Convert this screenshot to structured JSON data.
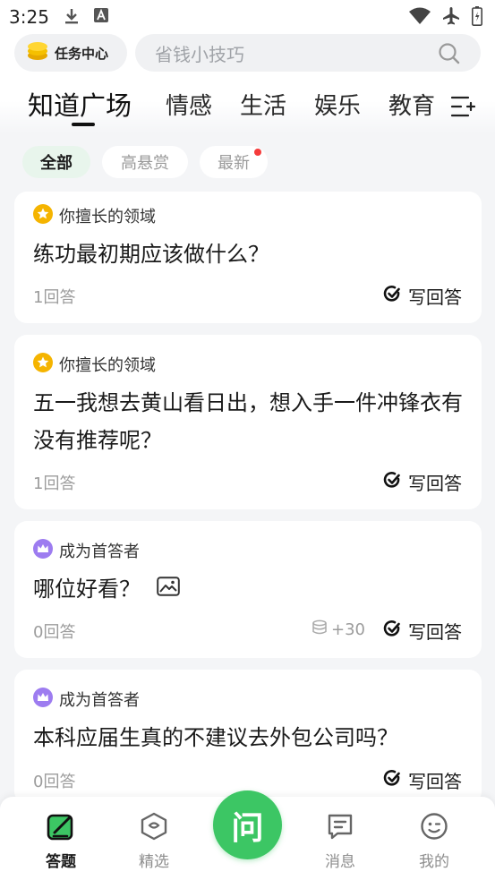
{
  "status_bar": {
    "time": "3:25",
    "left_icons": [
      "download-icon",
      "font-icon"
    ],
    "right_icons": [
      "wifi-icon",
      "airplane-icon",
      "battery-icon"
    ]
  },
  "header": {
    "task_center_label": "任务中心",
    "search_placeholder": "省钱小技巧"
  },
  "category_tabs": [
    {
      "label": "知道广场",
      "active": true
    },
    {
      "label": "情感",
      "active": false
    },
    {
      "label": "生活",
      "active": false
    },
    {
      "label": "娱乐",
      "active": false
    },
    {
      "label": "教育",
      "active": false
    }
  ],
  "filters": [
    {
      "label": "全部",
      "active": true
    },
    {
      "label": "高悬赏",
      "active": false
    },
    {
      "label": "最新",
      "active": false,
      "has_new_dot": true
    }
  ],
  "questions": [
    {
      "tag": "你擅长的领域",
      "tag_icon": "star-badge-icon",
      "title": "练功最初期应该做什么？",
      "answers": "1回答",
      "action": "写回答"
    },
    {
      "tag": "你擅长的领域",
      "tag_icon": "star-badge-icon",
      "title": "五一我想去黄山看日出，想入手一件冲锋衣有没有推荐呢？",
      "answers": "1回答",
      "action": "写回答"
    },
    {
      "tag": "成为首答者",
      "tag_icon": "crown-badge-icon",
      "title": "哪位好看？",
      "has_image": true,
      "answers": "0回答",
      "reward": "+30",
      "action": "写回答"
    },
    {
      "tag": "成为首答者",
      "tag_icon": "crown-badge-icon",
      "title": "本科应届生真的不建议去外包公司吗？",
      "answers": "0回答",
      "action": "写回答"
    }
  ],
  "bottom_nav": {
    "items": [
      {
        "label": "答题",
        "icon": "answer-icon",
        "active": true
      },
      {
        "label": "精选",
        "icon": "featured-icon",
        "active": false
      },
      {
        "label": "消息",
        "icon": "message-icon",
        "active": false
      },
      {
        "label": "我的",
        "icon": "profile-icon",
        "active": false
      }
    ],
    "ask_label": "问"
  },
  "colors": {
    "accent_green": "#3cc664",
    "gold": "#f5b400",
    "purple": "#9d7cf0",
    "red_dot": "#f53b3b"
  }
}
